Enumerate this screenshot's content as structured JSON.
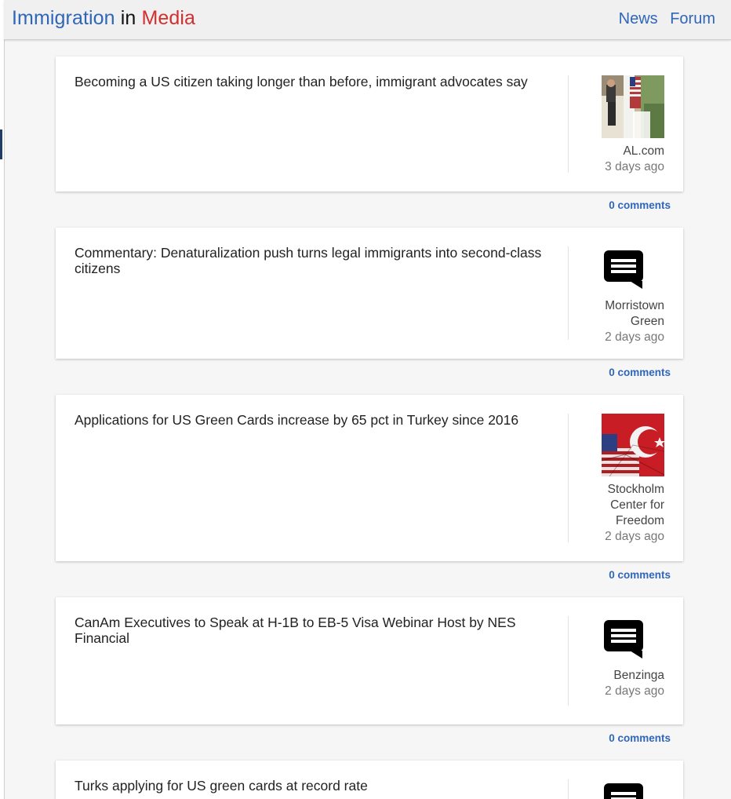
{
  "header": {
    "brand": {
      "part1": "Immigration",
      "part2": "in",
      "part3": "Media"
    },
    "nav": {
      "news": "News",
      "forum": "Forum"
    }
  },
  "articles": [
    {
      "title": "Becoming a US citizen taking longer than before, immigrant advocates say",
      "source": "AL.com",
      "age": "3 days ago",
      "comments": "0 comments",
      "image": "photo-porch-flag"
    },
    {
      "title": "Commentary: Denaturalization push turns legal immigrants into second-class citizens",
      "source": "Morristown Green",
      "age": "2 days ago",
      "comments": "0 comments",
      "image": "chat-icon"
    },
    {
      "title": "Applications for US Green Cards increase by 65 pct in Turkey since 2016",
      "source": "Stockholm Center for Freedom",
      "age": "2 days ago",
      "comments": "0 comments",
      "image": "photo-us-turkey-flags"
    },
    {
      "title": "CanAm Executives to Speak at H-1B to EB-5 Visa Webinar Host by NES Financial",
      "source": "Benzinga",
      "age": "2 days ago",
      "comments": "0 comments",
      "image": "chat-icon"
    },
    {
      "title": "Turks applying for US green cards at record rate",
      "image": "chat-icon"
    }
  ]
}
